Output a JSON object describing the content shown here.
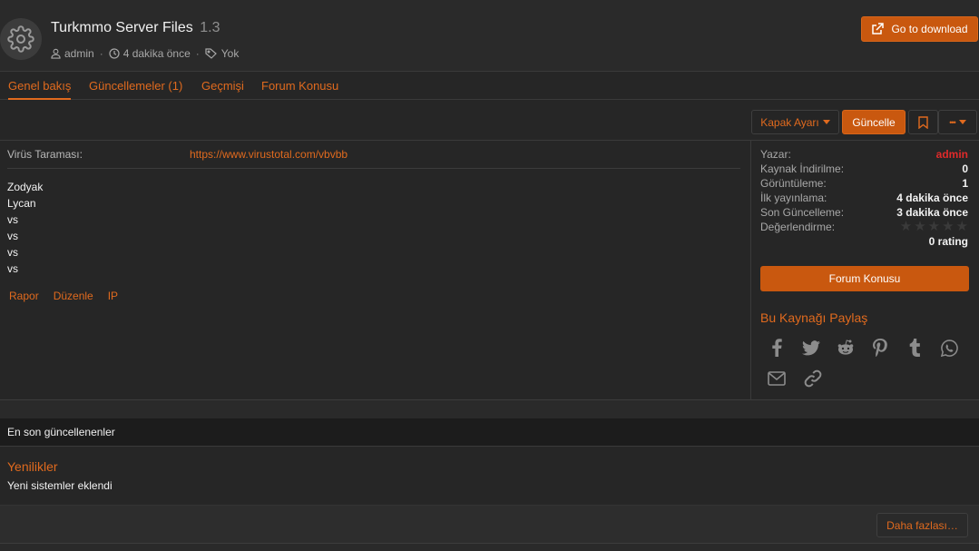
{
  "header": {
    "title": "Turkmmo Server Files",
    "version": "1.3",
    "author": "admin",
    "time": "4 dakika önce",
    "tags": "Yok",
    "download_label": "Go to download"
  },
  "tabs": [
    {
      "label": "Genel bakış"
    },
    {
      "label": "Güncellemeler (1)"
    },
    {
      "label": "Geçmişi"
    },
    {
      "label": "Forum Konusu"
    }
  ],
  "toolbar": {
    "cover_label": "Kapak Ayarı",
    "update_label": "Güncelle",
    "more_label": "•••"
  },
  "content": {
    "virus_label": "Virüs Taraması:",
    "virus_link": "https://www.virustotal.com/vbvbb",
    "lines": [
      "Zodyak",
      "Lycan",
      "vs",
      "vs",
      "vs",
      "vs"
    ],
    "actions": [
      "Rapor",
      "Düzenle",
      "IP"
    ]
  },
  "sidebar": {
    "rows": [
      {
        "key": "Yazar:",
        "value": "admin"
      },
      {
        "key": "Kaynak İndirilme:",
        "value": "0"
      },
      {
        "key": "Görüntüleme:",
        "value": "1"
      },
      {
        "key": "İlk yayınlama:",
        "value": "4 dakika önce"
      },
      {
        "key": "Son Güncelleme:",
        "value": "3 dakika önce"
      },
      {
        "key": "Değerlendirme:",
        "value": ""
      }
    ],
    "rating_text": "0 rating",
    "rating_value": 0,
    "rating_max": 5,
    "forum_button": "Forum Konusu",
    "share_title": "Bu Kaynağı Paylaş",
    "share_icons": [
      "facebook-icon",
      "twitter-icon",
      "reddit-icon",
      "pinterest-icon",
      "tumblr-icon",
      "whatsapp-icon",
      "email-icon",
      "link-icon"
    ]
  },
  "updates": {
    "heading": "En son güncellenenler",
    "item_title": "Yenilikler",
    "item_body": "Yeni sistemler eklendi",
    "more_label": "Daha fazlası…"
  },
  "colors": {
    "accent": "#e06a1e",
    "button": "#c9580f",
    "author": "#e02a2a"
  }
}
